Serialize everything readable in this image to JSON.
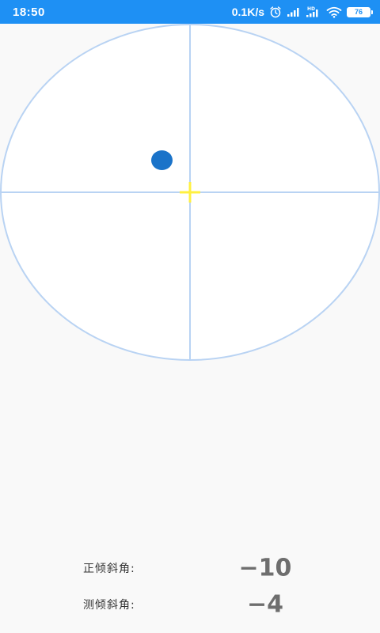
{
  "status_bar": {
    "time": "18:50",
    "net_speed": "0.1K/s",
    "battery_level": "76",
    "icons": [
      "alarm-icon",
      "signal-icon",
      "hd-signal-icon",
      "wifi-icon",
      "battery-icon"
    ]
  },
  "level": {
    "bubble_color": "#1a73c9",
    "crosshair_color": "#b9d3f3",
    "center_marker_color": "#fff040"
  },
  "readouts": {
    "pitch_label": "正倾斜角:",
    "pitch_value": "−10",
    "roll_label": "测倾斜角:",
    "roll_value": "−4"
  }
}
